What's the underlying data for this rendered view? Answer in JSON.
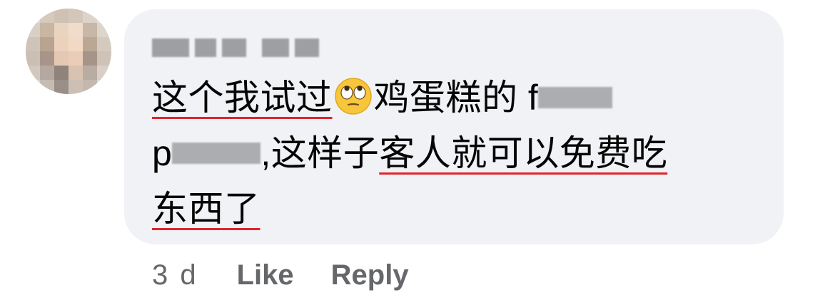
{
  "comment": {
    "author_name": "Mary Yap",
    "lines": [
      {
        "seg1": "这个我试过",
        "emoji": "rolling-eyes-face-icon",
        "seg2": "鸡蛋糕的 f",
        "blurred": "ood"
      },
      {
        "seg1": "p",
        "blurred": "anda",
        "seg2": ",这样子",
        "seg3": "客人就可以免费吃"
      },
      {
        "seg1": "东西了"
      }
    ]
  },
  "actions": {
    "timestamp": "3 d",
    "like_label": "Like",
    "reply_label": "Reply"
  },
  "colors": {
    "bubble": "#f0f2f5",
    "text": "#050505",
    "meta": "#65676b",
    "spellcheck_underline": "#e0242c"
  }
}
